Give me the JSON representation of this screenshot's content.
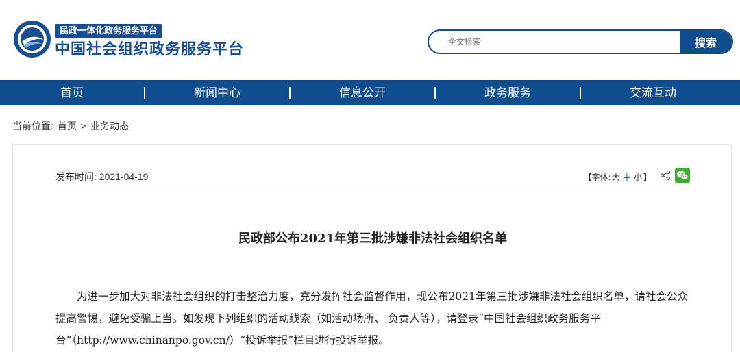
{
  "header": {
    "badge": "民政一体化政务服务平台",
    "site_title": "中国社会组织政务服务平台",
    "search": {
      "placeholder": "全文检索",
      "button_label": "搜索"
    }
  },
  "nav": {
    "items": [
      "首页",
      "新闻中心",
      "信息公开",
      "政务服务",
      "交流互动"
    ]
  },
  "breadcrumb": {
    "prefix": "当前位置:",
    "home": "首页",
    "separator": ">",
    "current": "业务动态"
  },
  "article": {
    "publish_label": "发布时间:",
    "publish_date": "2021-04-19",
    "font_size": {
      "open": "【字体:",
      "large": "大",
      "medium": "中",
      "small": "小",
      "close": "】"
    },
    "title": "民政部公布2021年第三批涉嫌非法社会组织名单",
    "body": "为进一步加大对非法社会组织的打击整治力度，充分发挥社会监督作用，现公布2021年第三批涉嫌非法社会组织名单，请社会公众提高警惕，避免受骗上当。如发现下列组织的活动线索（如活动场所、 负责人等），请登录“中国社会组织政务服务平台”（http://www.chinanpo.gov.cn/）“投诉举报”栏目进行投诉举报。"
  },
  "colors": {
    "brand": "#0f4d8f",
    "wechat": "#3cb034"
  }
}
